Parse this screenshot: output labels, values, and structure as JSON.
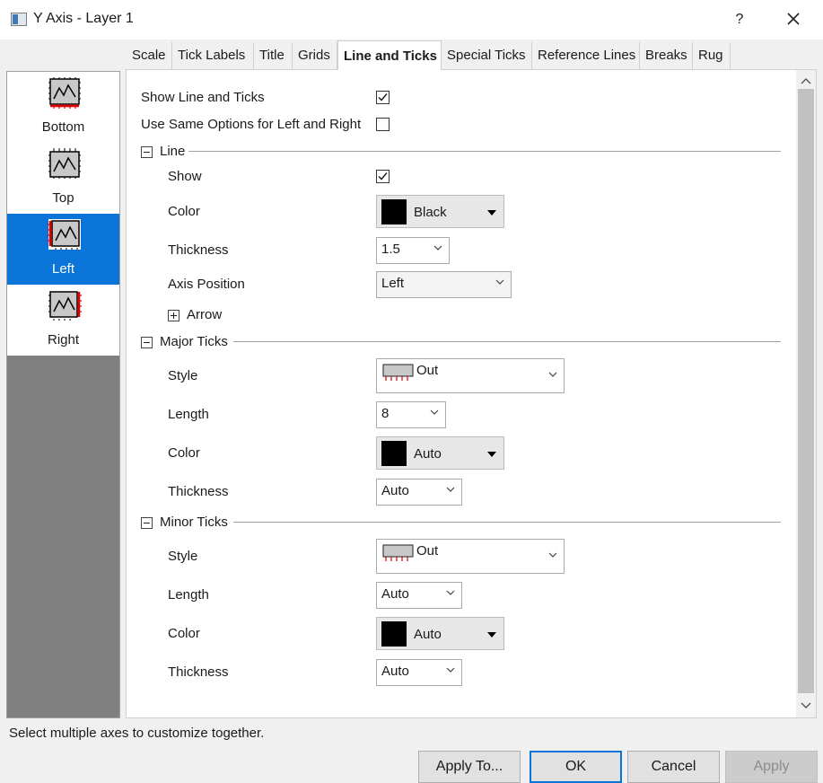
{
  "window": {
    "title": "Y Axis - Layer 1",
    "help_label": "?",
    "icons": {
      "app": "window-app-icon",
      "close": "close-icon"
    }
  },
  "tabs": [
    {
      "label": "Scale"
    },
    {
      "label": "Tick Labels"
    },
    {
      "label": "Title"
    },
    {
      "label": "Grids"
    },
    {
      "label": "Line and Ticks",
      "active": true
    },
    {
      "label": "Special Ticks"
    },
    {
      "label": "Reference Lines"
    },
    {
      "label": "Breaks"
    },
    {
      "label": "Rug"
    }
  ],
  "axes": [
    {
      "label": "Bottom",
      "icon": "axis-bottom-icon"
    },
    {
      "label": "Top",
      "icon": "axis-top-icon"
    },
    {
      "label": "Left",
      "icon": "axis-left-icon",
      "selected": true
    },
    {
      "label": "Right",
      "icon": "axis-right-icon"
    }
  ],
  "options": {
    "show_line_and_ticks": {
      "label": "Show Line and Ticks",
      "checked": true
    },
    "use_same": {
      "label": "Use Same Options for Left and Right",
      "checked": false
    }
  },
  "line": {
    "header": "Line",
    "show": {
      "label": "Show",
      "checked": true
    },
    "color": {
      "label": "Color",
      "value": "Black",
      "swatch": "#000000"
    },
    "thickness": {
      "label": "Thickness",
      "value": "1.5"
    },
    "axis_position": {
      "label": "Axis Position",
      "value": "Left"
    },
    "arrow": {
      "label": "Arrow"
    }
  },
  "major_ticks": {
    "header": "Major Ticks",
    "style": {
      "label": "Style",
      "value": "Out"
    },
    "length": {
      "label": "Length",
      "value": "8"
    },
    "color": {
      "label": "Color",
      "value": "Auto",
      "swatch": "#000000"
    },
    "thickness": {
      "label": "Thickness",
      "value": "Auto"
    }
  },
  "minor_ticks": {
    "header": "Minor Ticks",
    "style": {
      "label": "Style",
      "value": "Out"
    },
    "length": {
      "label": "Length",
      "value": "Auto"
    },
    "color": {
      "label": "Color",
      "value": "Auto",
      "swatch": "#000000"
    },
    "thickness": {
      "label": "Thickness",
      "value": "Auto"
    }
  },
  "status_text": "Select multiple axes to customize together.",
  "buttons": {
    "apply_to": "Apply To...",
    "ok": "OK",
    "cancel": "Cancel",
    "apply": "Apply"
  },
  "colors": {
    "accent": "#0a74d8",
    "list_background": "#808080"
  }
}
